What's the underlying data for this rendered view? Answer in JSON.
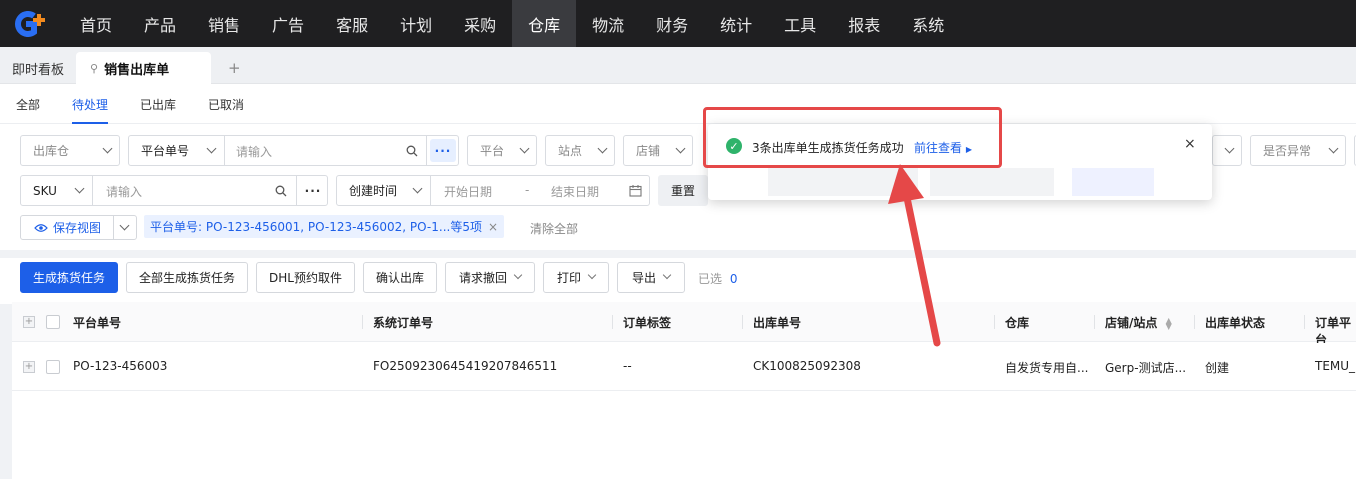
{
  "nav": {
    "logo": "G+",
    "items": [
      "首页",
      "产品",
      "销售",
      "广告",
      "客服",
      "计划",
      "采购",
      "仓库",
      "物流",
      "财务",
      "统计",
      "工具",
      "报表",
      "系统"
    ],
    "active": "仓库"
  },
  "tabs": {
    "dashboard": "即时看板",
    "current": "销售出库单",
    "add": "+"
  },
  "subtabs": {
    "all": "全部",
    "pending": "待处理",
    "shipped": "已出库",
    "cancelled": "已取消"
  },
  "filters": {
    "warehouse_placeholder": "出库仓",
    "platform_no_label": "平台单号",
    "input_placeholder": "请输入",
    "platform": "平台",
    "site": "站点",
    "shop": "店铺",
    "abnormal": "是否异常",
    "sku_label": "SKU",
    "sku_placeholder": "请输入",
    "created_time": "创建时间",
    "start_date": "开始日期",
    "date_sep": "-",
    "end_date": "结束日期",
    "reset": "重置",
    "save_view": "保存视图",
    "chip_text": "平台单号: PO-123-456001, PO-123-456002, PO-1...等5项",
    "chip_close": "×",
    "clear_all": "清除全部",
    "more_dots": "···"
  },
  "toolbar": {
    "generate_pick": "生成拣货任务",
    "generate_all": "全部生成拣货任务",
    "dhl": "DHL预约取件",
    "confirm": "确认出库",
    "withdraw": "请求撤回",
    "print": "打印",
    "export": "导出",
    "selected_label": "已选",
    "selected_count": "0"
  },
  "table": {
    "headers": [
      "平台单号",
      "系统订单号",
      "订单标签",
      "出库单号",
      "仓库",
      "店铺/站点",
      "出库单状态",
      "订单平台"
    ],
    "rows": [
      [
        "PO-123-456003",
        "FO2509230645419207846511",
        "--",
        "CK100825092308",
        "自发货专用自...",
        "Gerp-测试店...",
        "创建",
        "TEMU_"
      ]
    ]
  },
  "toast": {
    "message": "3条出库单生成拣货任务成功",
    "link": "前往查看",
    "close": "×"
  },
  "colors": {
    "brand": "#1d5fe8",
    "success": "#2fb36b",
    "annotation": "#e54848",
    "nav_bg": "#1f1f21"
  }
}
